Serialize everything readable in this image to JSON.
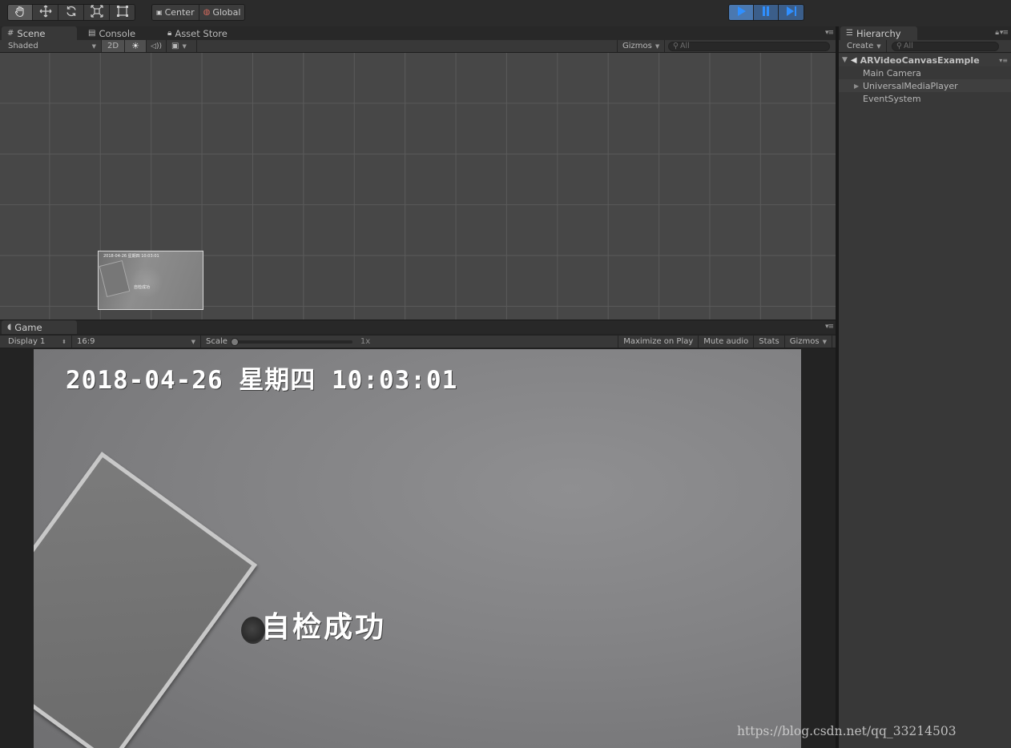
{
  "toolbar": {
    "tools": [
      {
        "name": "hand-tool",
        "icon": "hand-icon",
        "active": true
      },
      {
        "name": "move-tool",
        "icon": "move-arrows-icon",
        "active": false
      },
      {
        "name": "rotate-tool",
        "icon": "rotate-icon",
        "active": false
      },
      {
        "name": "scale-tool",
        "icon": "scale-icon",
        "active": false
      },
      {
        "name": "rect-tool",
        "icon": "rect-tool-icon",
        "active": false
      }
    ],
    "pivot_label": "Center",
    "space_label": "Global",
    "play_icons": [
      "play-icon",
      "pause-icon",
      "step-icon"
    ],
    "play_active": true
  },
  "scene_panel": {
    "tabs": [
      "Scene",
      "Console",
      "Asset Store"
    ],
    "shading_mode": "Shaded",
    "toggle_2d": "2D",
    "gizmos_label": "Gizmos",
    "search_placeholder": "All"
  },
  "game_panel": {
    "tab": "Game",
    "display": "Display 1",
    "aspect": "16:9",
    "scale_label": "Scale",
    "scale_value": "1x",
    "maximize_label": "Maximize on Play",
    "mute_label": "Mute audio",
    "stats_label": "Stats",
    "gizmos_label": "Gizmos",
    "video_overlay": {
      "datetime": "2018-04-26 星期四 10:03:01",
      "status_text": "自检成功"
    }
  },
  "hierarchy": {
    "tab": "Hierarchy",
    "create_label": "Create",
    "search_placeholder": "All",
    "scene_name": "ARVideoCanvasExample",
    "items": [
      {
        "label": "Main Camera",
        "expandable": false,
        "selected": false
      },
      {
        "label": "UniversalMediaPlayer",
        "expandable": true,
        "selected": true
      },
      {
        "label": "EventSystem",
        "expandable": false,
        "selected": false
      }
    ]
  },
  "watermark": "https://blog.csdn.net/qq_33214503",
  "colors": {
    "accent_play": "#4a78b0",
    "panel_bg": "#464646",
    "toolbar_bg": "#2b2b2b"
  }
}
